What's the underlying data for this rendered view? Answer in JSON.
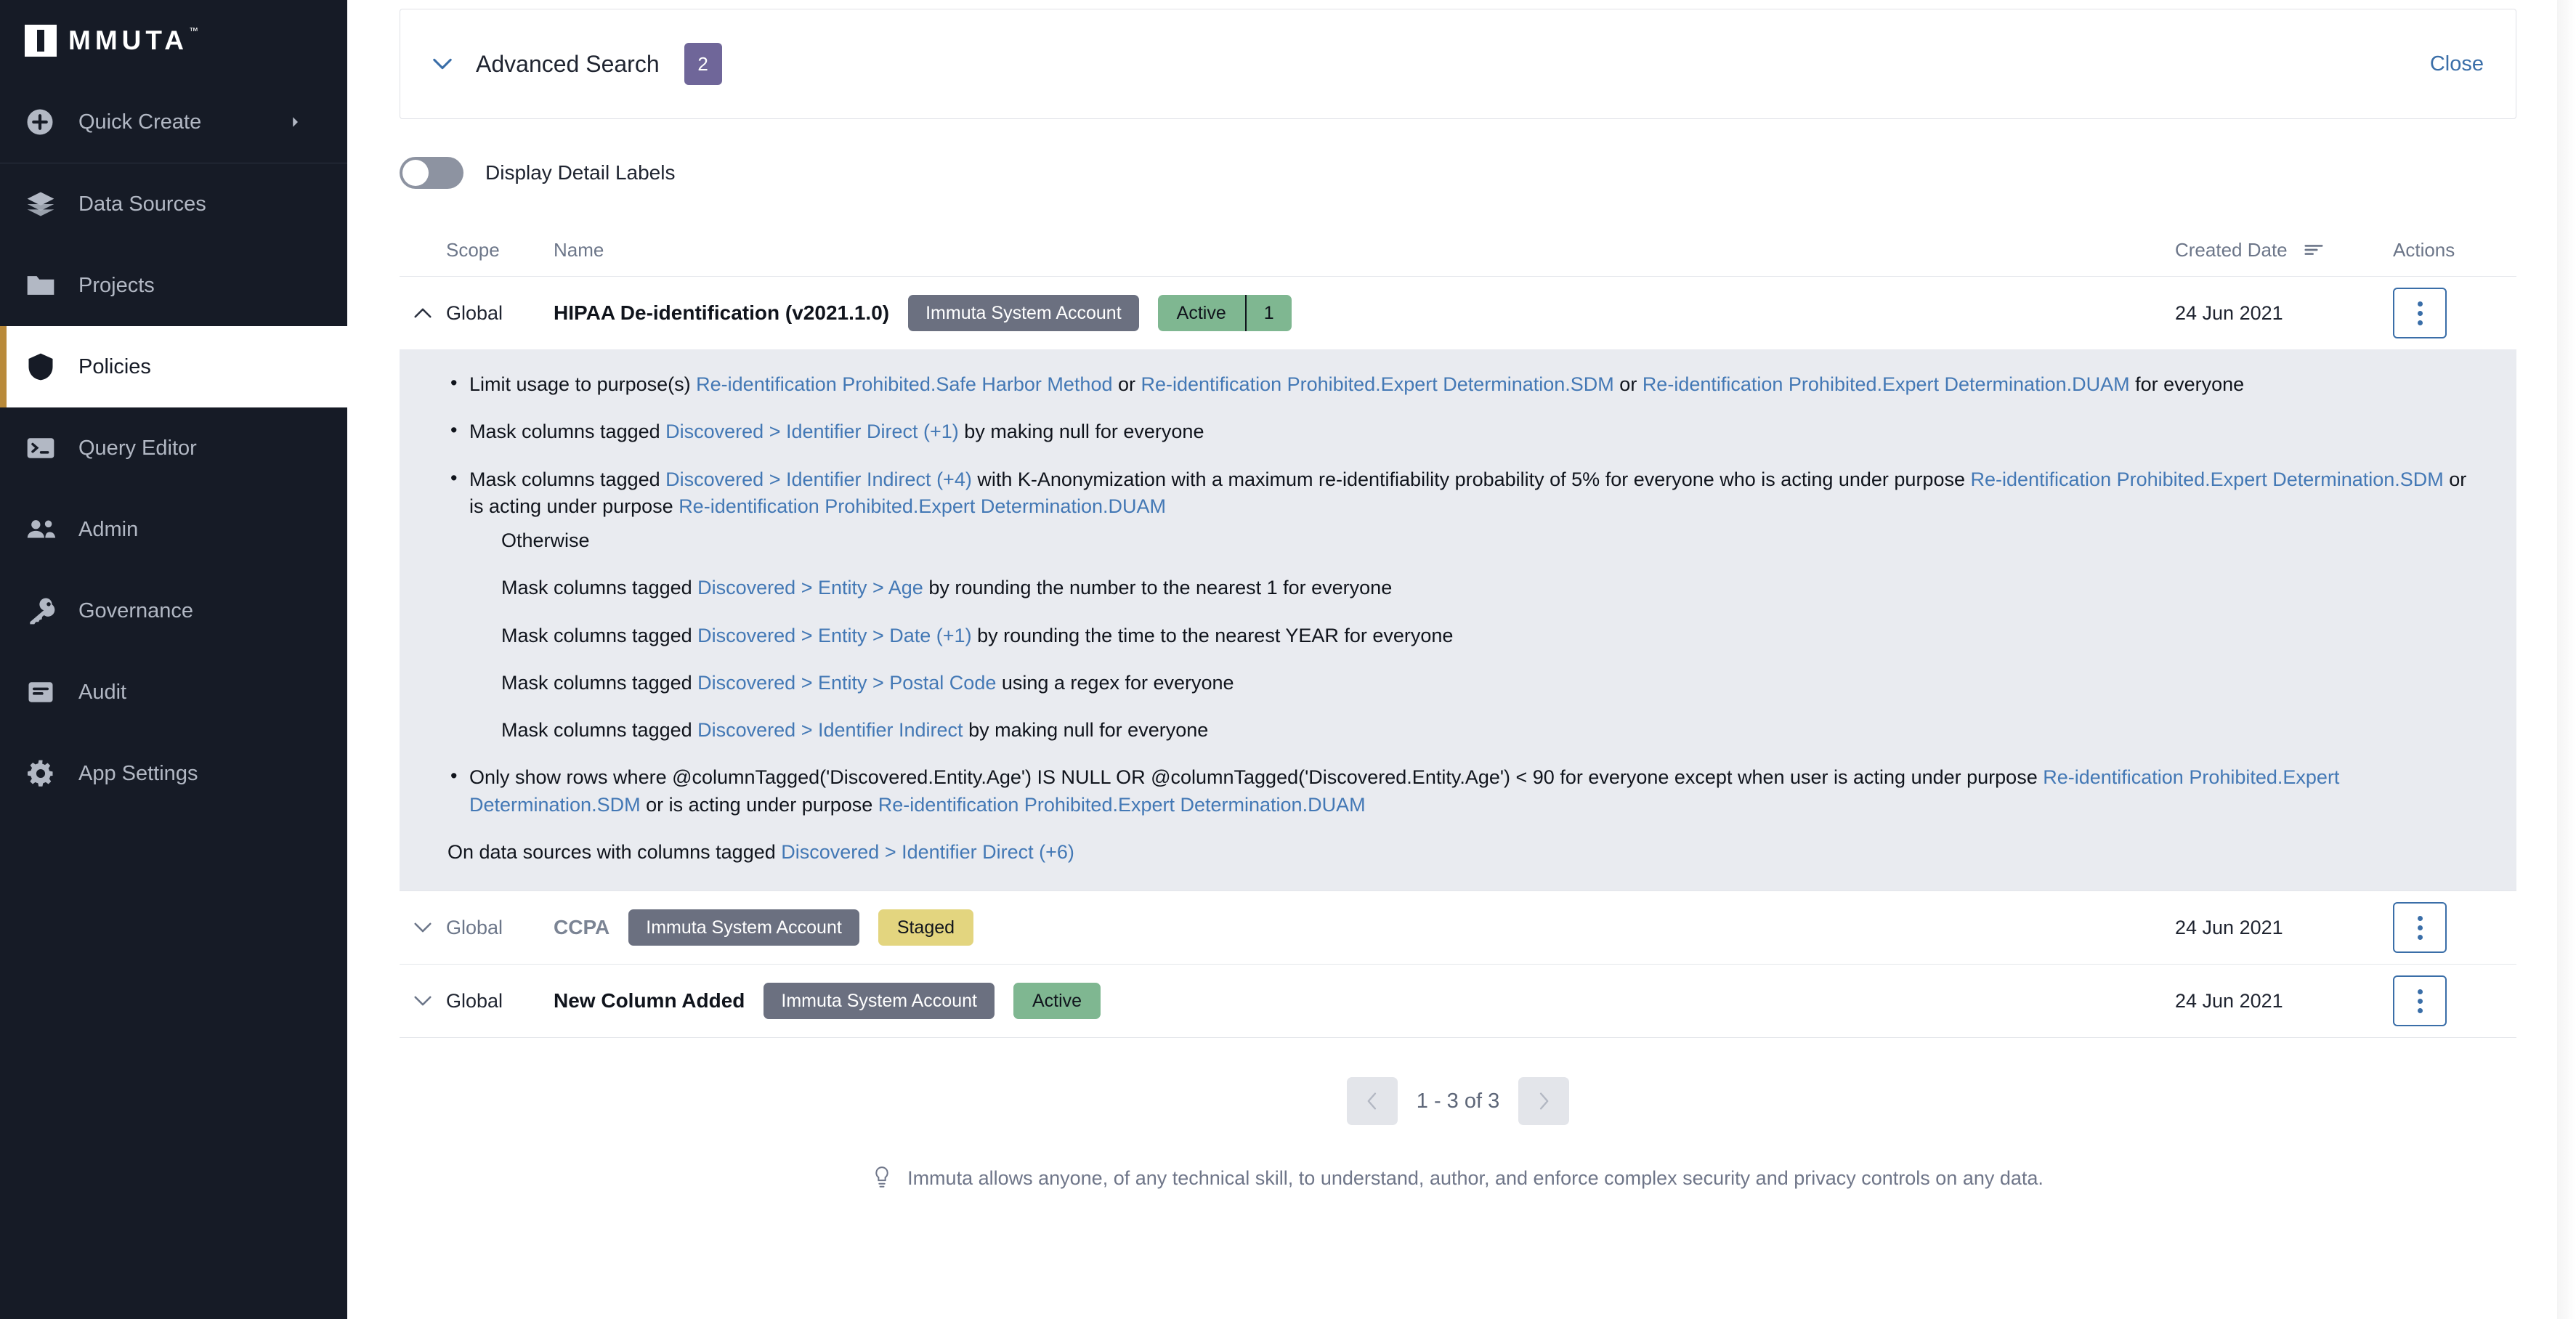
{
  "sidebar": {
    "brand": {
      "name": "MMUTA",
      "tm": "™"
    },
    "quick_create": {
      "label": "Quick Create",
      "icon": "plus-circle-icon",
      "caret": "chevron-right-icon"
    },
    "items": [
      {
        "label": "Data Sources",
        "icon": "layers-icon"
      },
      {
        "label": "Projects",
        "icon": "folder-icon"
      },
      {
        "label": "Policies",
        "icon": "shield-icon",
        "active": true
      },
      {
        "label": "Query Editor",
        "icon": "terminal-icon"
      },
      {
        "label": "Admin",
        "icon": "users-icon"
      },
      {
        "label": "Governance",
        "icon": "key-icon"
      },
      {
        "label": "Audit",
        "icon": "list-icon"
      },
      {
        "label": "App Settings",
        "icon": "gear-icon"
      }
    ],
    "active_accent": "#b98a3a",
    "background": "#161b26"
  },
  "advanced_search": {
    "title": "Advanced Search",
    "badge_count": "2",
    "badge_color": "#6f6699",
    "close_label": "Close",
    "caret_icon": "chevron-down-icon"
  },
  "display_detail_labels": {
    "label": "Display Detail Labels",
    "state": "off"
  },
  "table": {
    "headers": {
      "scope": "Scope",
      "name": "Name",
      "created_date": "Created Date",
      "actions": "Actions",
      "sort_icon": "sort-descending-icon"
    },
    "rows": [
      {
        "expanded": true,
        "caret_icon": "chevron-up-icon",
        "scope": "Global",
        "name": "HIPAA De-identification (v2021.1.0)",
        "name_style": "bold",
        "account_pill": "Immuta System Account",
        "status": {
          "label": "Active",
          "count": "1",
          "color": "#7fb791"
        },
        "created_date": "24 Jun 2021",
        "actions_icon": "kebab-menu-icon"
      },
      {
        "expanded": false,
        "caret_icon": "chevron-down-icon",
        "scope": "Global",
        "name": "CCPA",
        "name_style": "muted",
        "account_pill": "Immuta System Account",
        "status": {
          "label": "Staged",
          "count": "",
          "color": "#e3d57f"
        },
        "created_date": "24 Jun 2021",
        "actions_icon": "kebab-menu-icon"
      },
      {
        "expanded": false,
        "caret_icon": "chevron-down-icon",
        "scope": "Global",
        "name": "New Column Added",
        "name_style": "bold",
        "account_pill": "Immuta System Account",
        "status": {
          "label": "Active",
          "count": "",
          "color": "#7fb791"
        },
        "created_date": "24 Jun 2021",
        "actions_icon": "kebab-menu-icon"
      }
    ]
  },
  "detail": {
    "b1_p1": "Limit usage to purpose(s) ",
    "b1_l1": "Re-identification Prohibited.Safe Harbor Method",
    "b1_p2": " or ",
    "b1_l2": "Re-identification Prohibited.Expert Determination.SDM",
    "b1_p3": " or ",
    "b1_l3": "Re-identification Prohibited.Expert Determination.DUAM",
    "b1_p4": " for everyone",
    "b2_p1": "Mask columns tagged ",
    "b2_l1": "Discovered > Identifier Direct (+1)",
    "b2_p2": " by making null for everyone",
    "b3_p1": "Mask columns tagged ",
    "b3_l1": "Discovered > Identifier Indirect (+4)",
    "b3_p2": " with K-Anonymization with a maximum re-identifiability probability of 5% for everyone who is acting under purpose ",
    "b3_l2": "Re-identification Prohibited.Expert Determination.SDM",
    "b3_p3": " or is acting under purpose ",
    "b3_l3": "Re-identification Prohibited.Expert Determination.DUAM",
    "otherwise_head": "Otherwise",
    "ow1_p1": "Mask columns tagged ",
    "ow1_l1": "Discovered > Entity > Age",
    "ow1_p2": " by rounding the number to the nearest 1 for everyone",
    "ow2_p1": "Mask columns tagged ",
    "ow2_l1": "Discovered > Entity > Date (+1)",
    "ow2_p2": " by rounding the time to the nearest YEAR for everyone",
    "ow3_p1": "Mask columns tagged ",
    "ow3_l1": "Discovered > Entity > Postal Code",
    "ow3_p2": " using a regex for everyone",
    "ow4_p1": "Mask columns tagged ",
    "ow4_l1": "Discovered > Identifier Indirect",
    "ow4_p2": " by making null for everyone",
    "b4_p1": "Only show rows where @columnTagged('Discovered.Entity.Age') IS NULL OR @columnTagged('Discovered.Entity.Age') < 90 for everyone except when user is acting under purpose ",
    "b4_l1": "Re-identification Prohibited.Expert Determination.SDM",
    "b4_p2": " or is acting under purpose ",
    "b4_l2": "Re-identification Prohibited.Expert Determination.DUAM",
    "foot_p1": "On data sources with columns tagged ",
    "foot_l1": "Discovered > Identifier Direct (+6)"
  },
  "pagination": {
    "prev_icon": "chevron-left-icon",
    "next_icon": "chevron-right-icon",
    "label": "1 - 3 of 3"
  },
  "footer": {
    "icon": "lightbulb-icon",
    "text": "Immuta allows anyone, of any technical skill, to understand, author, and enforce complex security and privacy controls on any data."
  }
}
